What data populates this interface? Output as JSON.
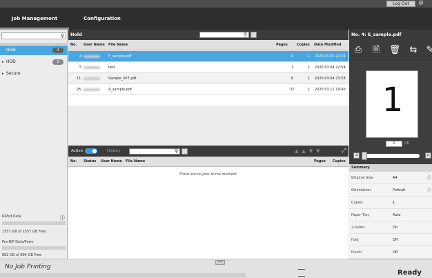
{
  "header": {
    "logout_label": "Log Out"
  },
  "tabs": [
    {
      "label": "Job Management"
    },
    {
      "label": "Configuration"
    }
  ],
  "sidebar": {
    "items": [
      {
        "label": "Hold",
        "count": "4"
      },
      {
        "label": "HDD",
        "count": "2"
      },
      {
        "label": "Secure",
        "count": ""
      }
    ],
    "disk1_label": "RIPed Data",
    "disk1_free": "1557 GB of 1557 GB Free",
    "disk2_label": "Pre-RIP Data/Form",
    "disk2_free": "882 GB of 884 GB Free"
  },
  "hold": {
    "title": "Hold",
    "columns": {
      "no": "No.",
      "user": "User Name",
      "file": "File Name",
      "pages": "Pages",
      "copies": "Copies",
      "date": "Date Modified"
    },
    "rows": [
      {
        "no": "4",
        "file": "E_sample.pdf",
        "pages": "6",
        "copies": "1",
        "date": "2020.03.05 22:55"
      },
      {
        "no": "5",
        "file": "test",
        "pages": "1",
        "copies": "1",
        "date": "2020.03.04 22:54"
      },
      {
        "no": "11",
        "file": "Sample_007.pdf",
        "pages": "6",
        "copies": "1",
        "date": "2020.03.04 23:28"
      },
      {
        "no": "25",
        "file": "A_sample.pdf",
        "pages": "32",
        "copies": "1",
        "date": "2020.03.12 19:40"
      }
    ]
  },
  "active": {
    "active_label": "Active",
    "history_label": "History",
    "columns": {
      "no": "No.",
      "status": "Status",
      "user": "User Name",
      "file": "File Name",
      "pages": "Pages",
      "copies": "Copies"
    },
    "empty_text": "There are no jobs at the moment."
  },
  "preview": {
    "title": "No. 4: E_sample.pdf",
    "page_number": "1",
    "page_input": "1",
    "page_total": "/ 6"
  },
  "summary": {
    "title": "Summary",
    "rows": [
      {
        "k": "Original Size",
        "v": "A4"
      },
      {
        "k": "Orientation",
        "v": "Portrait"
      },
      {
        "k": "Copies",
        "v": "1"
      },
      {
        "k": "Paper Tray",
        "v": "Auto"
      },
      {
        "k": "2-Sided",
        "v": "On"
      },
      {
        "k": "Fold",
        "v": "Off"
      },
      {
        "k": "Punch",
        "v": "Off"
      }
    ]
  },
  "status": {
    "printing": "No Job Printing",
    "ready": "Ready"
  }
}
